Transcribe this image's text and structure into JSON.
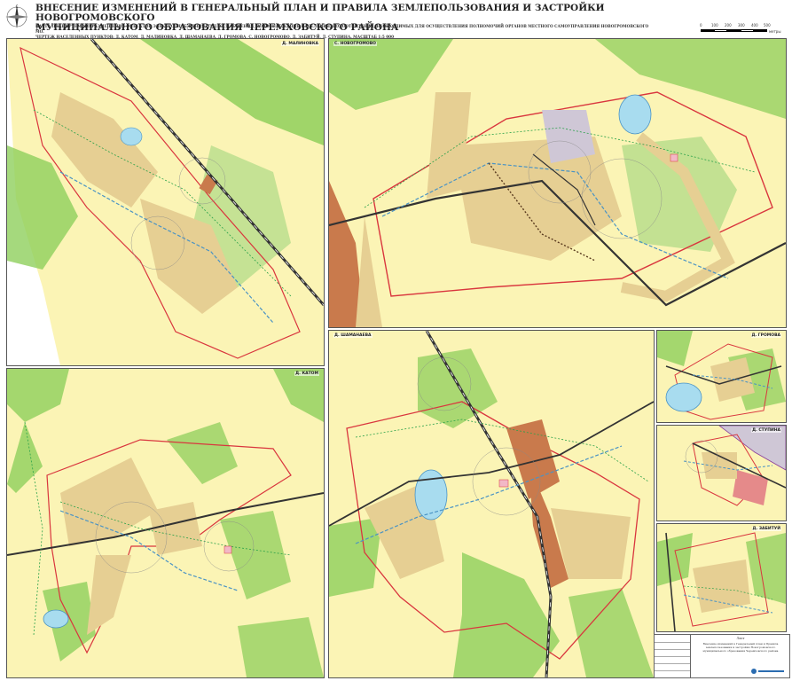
{
  "header": {
    "title_line1": "ВНЕСЕНИЕ ИЗМЕНЕНИЙ В ГЕНЕРАЛЬНЫЙ ПЛАН И ПРАВИЛА ЗЕМЛЕПОЛЬЗОВАНИЯ И ЗАСТРОЙКИ НОВОГРОМОВСКОГО",
    "title_line2": "МУНИЦИПАЛЬНОГО ОБРАЗОВАНИЯ ЧЕРЕМХОВСКОГО РАЙОНА",
    "subtitle_line1": "КАРТА ПЛАНИРУЕМОГО РАЗМЕЩЕНИЯ ОБЪЕКТОВ ЭЛЕКТРОСНАБЖЕНИЯ, ТЕПЛОСНАБЖЕНИЯ, ВОДОСНАБЖЕНИЯ НАСЕЛЕНИЯ, ВОДООТВЕДЕНИЯ, НЕОБХОДИМЫХ ДЛЯ ОСУЩЕСТВЛЕНИЯ ПОЛНОМОЧИЙ ОРГАНОВ МЕСТНОГО САМОУПРАВЛЕНИЯ НОВОГРОМОВСКОГО МО.",
    "subtitle_line2": "ЧЕРТЕЖ НАСЕЛЕННЫХ ПУНКТОВ: Д. КАТОМ, Д. МАЛИНОВКА, Д. ШАМАНАЕВА, Д. ГРОМОВА, С. НОВОГРОМОВО, Д. ЗАБИТУЙ, Д. СТУПИНА. МАСШТАБ 1:5 000"
  },
  "scale_bar": {
    "labels": [
      "0",
      "100",
      "200",
      "300",
      "400",
      "500"
    ],
    "unit": "метры"
  },
  "compass": {
    "icon": "compass-rose-icon"
  },
  "panels": {
    "malinovka": "Д. МАЛИНОВКА",
    "novogromovo": "С. НОВОГРОМОВО",
    "katom": "Д. КАТОМ",
    "shamanaeva": "Д. ШАМАНАЕВА",
    "gromova": "Д. ГРОМОВА",
    "stupina": "Д. СТУПИНА",
    "zabituy": "Д. ЗАБИТУЙ"
  },
  "stamp": {
    "header": "Лист",
    "text": "Внесение изменений в Генеральный план и Правила землепользования и застройки Новогромовского муниципального образования Черемховского района"
  },
  "colors": {
    "background_yellow": "#fbf4b5",
    "forest_green": "#8fcf5c",
    "boundary_red": "#d9363e",
    "road_black": "#333333",
    "water_blue": "#a8dcef",
    "residential_tan": "#e6cf93",
    "industrial_brown": "#c97a4c"
  }
}
